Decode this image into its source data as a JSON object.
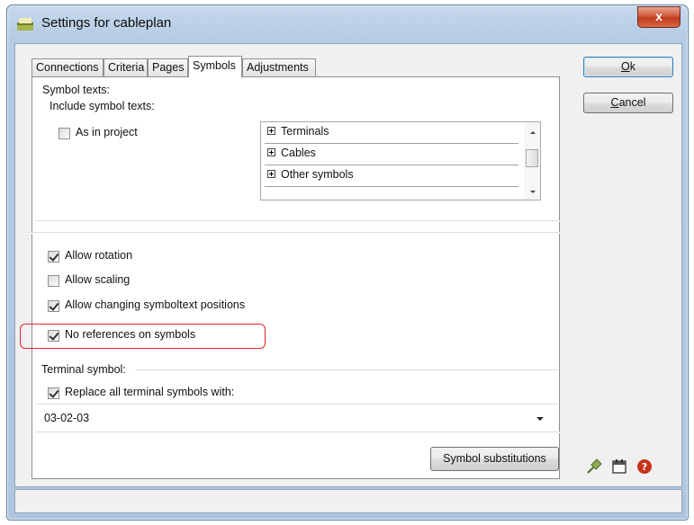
{
  "window": {
    "title": "Settings for cableplan",
    "close_glyph": "x"
  },
  "tabs": [
    {
      "label": "Connections"
    },
    {
      "label": "Criteria"
    },
    {
      "label": "Pages"
    },
    {
      "label": "Symbols",
      "active": true
    },
    {
      "label": "Adjustments"
    }
  ],
  "symbol_texts": {
    "heading": "Symbol texts:",
    "include_label": "Include symbol texts:",
    "as_in_project": {
      "label": "As in project",
      "checked": false
    },
    "tree_items": [
      "Terminals",
      "Cables",
      "Other symbols"
    ]
  },
  "options": [
    {
      "label": "Allow rotation",
      "checked": true
    },
    {
      "label": "Allow scaling",
      "checked": false
    },
    {
      "label": "Allow changing symboltext positions",
      "checked": true
    },
    {
      "label": "No references on symbols",
      "checked": true,
      "highlighted": true
    }
  ],
  "terminal_symbol": {
    "heading": "Terminal symbol:",
    "replace": {
      "label": "Replace all terminal symbols with:",
      "checked": true
    },
    "selected_value": "03-02-03"
  },
  "buttons": {
    "symbol_substitutions": "Symbol substitutions",
    "ok": {
      "mnemonic": "O",
      "rest": "k"
    },
    "cancel": {
      "mnemonic": "C",
      "rest": "ancel"
    }
  },
  "footer_icons": [
    "pin-icon",
    "calendar-icon",
    "help-icon"
  ],
  "colors": {
    "highlight": "#e8232a",
    "title_bar": "#b4cbe4",
    "help_icon": "#c8321c"
  }
}
